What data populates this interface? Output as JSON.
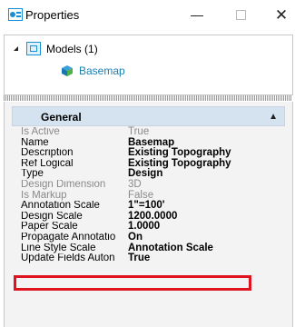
{
  "window": {
    "title": "Properties",
    "minimize_label": "—",
    "maximize_label": "□",
    "close_label": "✕"
  },
  "tree": {
    "root_label": "Models (1)",
    "child_label": "Basemap"
  },
  "panel": {
    "group_title": "General",
    "rows": [
      {
        "name": "Is Active",
        "value": "True",
        "style": "readonly"
      },
      {
        "name": "Name",
        "value": "Basemap",
        "style": "bold"
      },
      {
        "name": "Description",
        "value": "Existing Topography",
        "style": "bold"
      },
      {
        "name": "Ref Logical",
        "value": "Existing Topography",
        "style": "bold"
      },
      {
        "name": "Type",
        "value": "Design",
        "style": "bold"
      },
      {
        "name": "Design Dimension",
        "value": "3D",
        "style": "readonly"
      },
      {
        "name": "Is Markup",
        "value": "False",
        "style": "readonly"
      },
      {
        "name": "Annotation Scale",
        "value": "1\"=100'",
        "style": "bold"
      },
      {
        "name": "Design Scale",
        "value": "1200.0000",
        "style": "bold"
      },
      {
        "name": "Paper Scale",
        "value": "1.0000",
        "style": "bold"
      },
      {
        "name": "Propagate Annotatio",
        "value": "On",
        "style": "bold"
      },
      {
        "name": "Line Style Scale",
        "value": "Annotation Scale",
        "style": "bold"
      },
      {
        "name": "Update Fields Auton",
        "value": "True",
        "style": "bold"
      }
    ]
  },
  "colors": {
    "accent": "#1a8fd1",
    "highlight_border": "#e0141e",
    "group_header": "#d5e2f0"
  }
}
